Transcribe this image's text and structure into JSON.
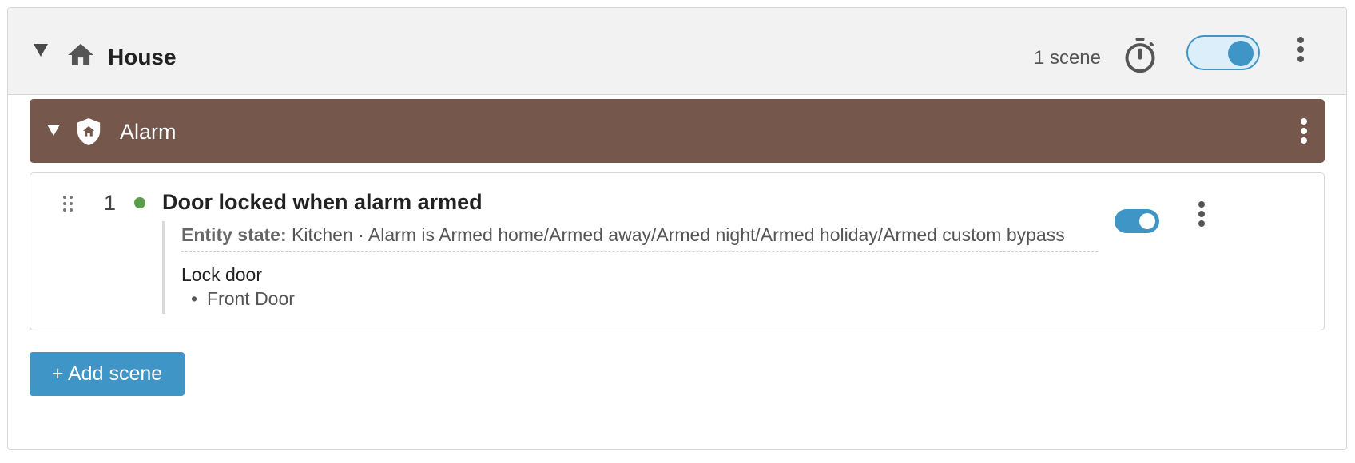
{
  "room": {
    "title": "House",
    "scene_count": "1 scene",
    "enabled": true,
    "icon": "home-icon"
  },
  "group": {
    "title": "Alarm",
    "color": "#75574b",
    "icon": "shield-home-icon"
  },
  "scene": {
    "number": "1",
    "status_color": "#5a9e4b",
    "title": "Door locked when alarm armed",
    "condition_label": "Entity state:",
    "condition_text": "Kitchen · Alarm is Armed home/Armed away/Armed night/Armed holiday/Armed custom bypass",
    "action_title": "Lock door",
    "action_targets": [
      "Front Door"
    ],
    "enabled": true
  },
  "add_button_label": "+ Add scene",
  "colors": {
    "accent": "#3f95c6",
    "header_bg": "#f2f2f2"
  }
}
